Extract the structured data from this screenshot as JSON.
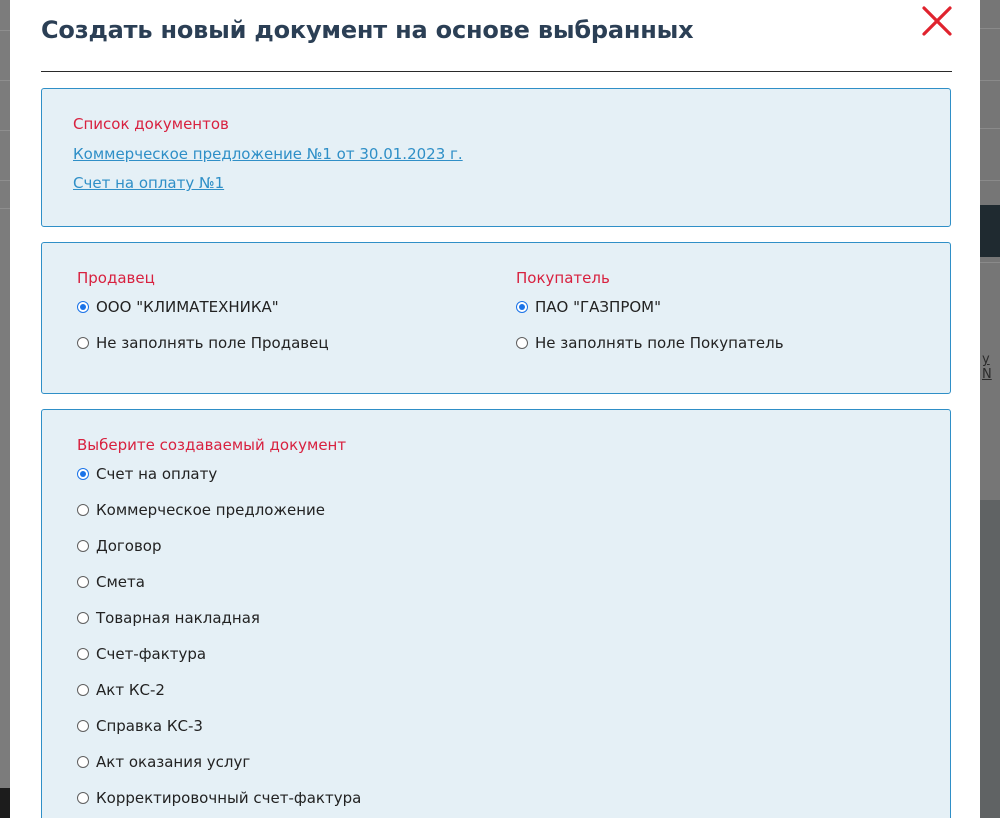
{
  "modal": {
    "title": "Создать новый документ на основе выбранных"
  },
  "documents": {
    "heading": "Список документов",
    "links": [
      "Коммерческое предложение №1 от 30.01.2023 г.",
      "Счет на оплату №1"
    ]
  },
  "seller": {
    "heading": "Продавец",
    "options": [
      {
        "label": "ООО \"КЛИМАТЕХНИКА\"",
        "checked": true
      },
      {
        "label": "Не заполнять поле Продавец",
        "checked": false
      }
    ]
  },
  "buyer": {
    "heading": "Покупатель",
    "options": [
      {
        "label": "ПАО \"ГАЗПРОМ\"",
        "checked": true
      },
      {
        "label": "Не заполнять поле Покупатель",
        "checked": false
      }
    ]
  },
  "doc_type": {
    "heading": "Выберите создаваемый документ",
    "options": [
      {
        "label": "Счет на оплату",
        "checked": true
      },
      {
        "label": "Коммерческое предложение",
        "checked": false
      },
      {
        "label": "Договор",
        "checked": false
      },
      {
        "label": "Смета",
        "checked": false
      },
      {
        "label": "Товарная накладная",
        "checked": false
      },
      {
        "label": "Счет-фактура",
        "checked": false
      },
      {
        "label": "Акт КС-2",
        "checked": false
      },
      {
        "label": "Справка КС-3",
        "checked": false
      },
      {
        "label": "Акт оказания услуг",
        "checked": false
      },
      {
        "label": "Корректировочный счет-фактура",
        "checked": false
      }
    ]
  },
  "colors": {
    "accent_red": "#d8213f",
    "title": "#2b3f55",
    "link": "#2f8fc7",
    "panel_bg": "#e5f0f6",
    "panel_border": "#2f8fc7",
    "radio_checked": "#1a73e8"
  }
}
